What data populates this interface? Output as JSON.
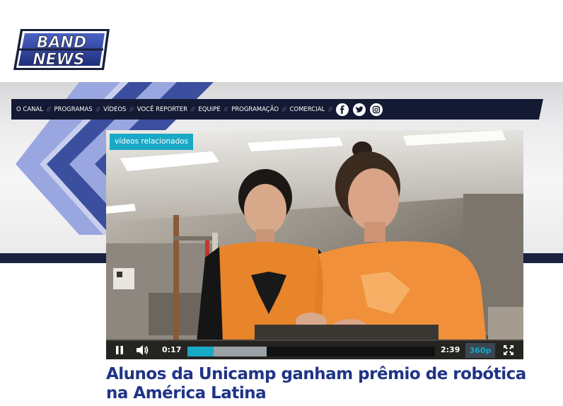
{
  "brand": {
    "logo_line1": "BAND",
    "logo_line2": "NEWS"
  },
  "nav": {
    "items": [
      {
        "label": "O CANAL"
      },
      {
        "label": "PROGRAMAS"
      },
      {
        "label": "VÍDEOS"
      },
      {
        "label": "VOCÊ REPORTER"
      },
      {
        "label": "EQUIPE"
      },
      {
        "label": "PROGRAMAÇÃO"
      },
      {
        "label": "COMERCIAL"
      }
    ],
    "separator": "//",
    "social": [
      "facebook-icon",
      "twitter-icon",
      "instagram-icon"
    ]
  },
  "video": {
    "related_label": "vídeos relacionados",
    "current_time": "0:17",
    "duration": "2:39",
    "quality": "360p",
    "progress_fraction": 0.107,
    "buffered_fraction": 0.32,
    "state": "playing"
  },
  "article": {
    "headline": "Alunos da Unicamp ganham prêmio de robótica na América Latina"
  },
  "colors": {
    "navy": "#141a33",
    "accent": "#19a8c6",
    "headline": "#1f3486",
    "stripe_light": "#9aa6df",
    "stripe_dark": "#3c4f9e"
  }
}
